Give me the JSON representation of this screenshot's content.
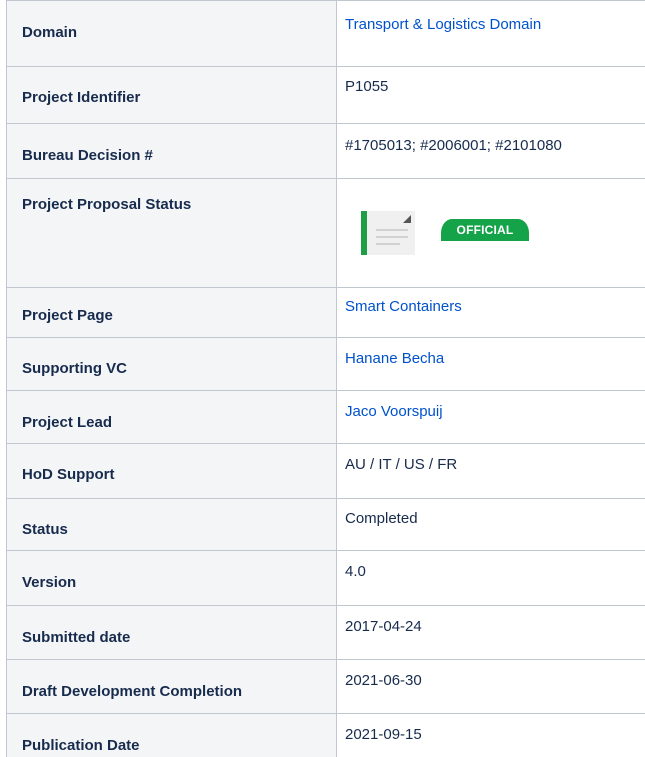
{
  "rows": [
    {
      "label": "Domain",
      "value": "Transport & Logistics Domain",
      "link": true
    },
    {
      "label": "Project Identifier",
      "value": "P1055",
      "link": false
    },
    {
      "label": "Bureau Decision #",
      "value": "#1705013; #2006001; #2101080",
      "link": false
    },
    {
      "label": "Project Proposal Status",
      "badge": "OFFICIAL",
      "icon": "document-thumbnail-icon"
    },
    {
      "label": "Project Page",
      "value": "Smart Containers",
      "link": true
    },
    {
      "label": "Supporting VC",
      "value": "Hanane Becha",
      "link": true
    },
    {
      "label": "Project Lead",
      "value": "Jaco Voorspuij",
      "link": true
    },
    {
      "label": "HoD Support",
      "value": "AU / IT / US / FR",
      "link": false
    },
    {
      "label": "Status",
      "value": "Completed",
      "link": false
    },
    {
      "label": "Version",
      "value": "4.0",
      "link": false
    },
    {
      "label": "Submitted date",
      "value": "2017-04-24",
      "link": false
    },
    {
      "label": "Draft Development Completion",
      "value": "2021-06-30",
      "link": false
    },
    {
      "label": "Publication Date",
      "value": "2021-09-15",
      "link": false
    }
  ],
  "colors": {
    "link": "#0052cc",
    "label_bg": "#f4f5f7",
    "border": "#c1c7d0",
    "badge_bg": "#15a34a",
    "doc_accent": "#1f9e45"
  }
}
